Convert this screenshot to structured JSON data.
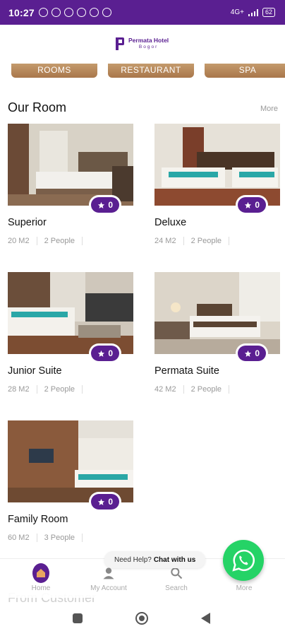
{
  "status_bar": {
    "time": "10:27",
    "network": "4G+",
    "battery": "62"
  },
  "header": {
    "logo_name": "Permata Hotel",
    "logo_city": "Bogor"
  },
  "categories": [
    {
      "label": "ROOMS"
    },
    {
      "label": "RESTAURANT"
    },
    {
      "label": "SPA"
    }
  ],
  "section": {
    "title": "Our Room",
    "more": "More"
  },
  "rooms": [
    {
      "name": "Superior",
      "size": "20 M2",
      "people": "2 People",
      "rating": "0"
    },
    {
      "name": "Deluxe",
      "size": "24 M2",
      "people": "2 People",
      "rating": "0"
    },
    {
      "name": "Junior Suite",
      "size": "28 M2",
      "people": "2 People",
      "rating": "0"
    },
    {
      "name": "Permata Suite",
      "size": "42 M2",
      "people": "2 People",
      "rating": "0"
    },
    {
      "name": "Family Room",
      "size": "60 M2",
      "people": "3 People",
      "rating": "0"
    }
  ],
  "next_section": {
    "title": "From Customer"
  },
  "help": {
    "prefix": "Need Help?",
    "link": "Chat with us"
  },
  "bottom_nav": [
    {
      "label": "Home",
      "icon": "home-icon"
    },
    {
      "label": "My Account",
      "icon": "user-icon"
    },
    {
      "label": "Search",
      "icon": "search-icon"
    },
    {
      "label": "More",
      "icon": "more-icon"
    }
  ],
  "colors": {
    "brand": "#5a1f91",
    "whatsapp": "#25d366",
    "category": "#b08255"
  }
}
